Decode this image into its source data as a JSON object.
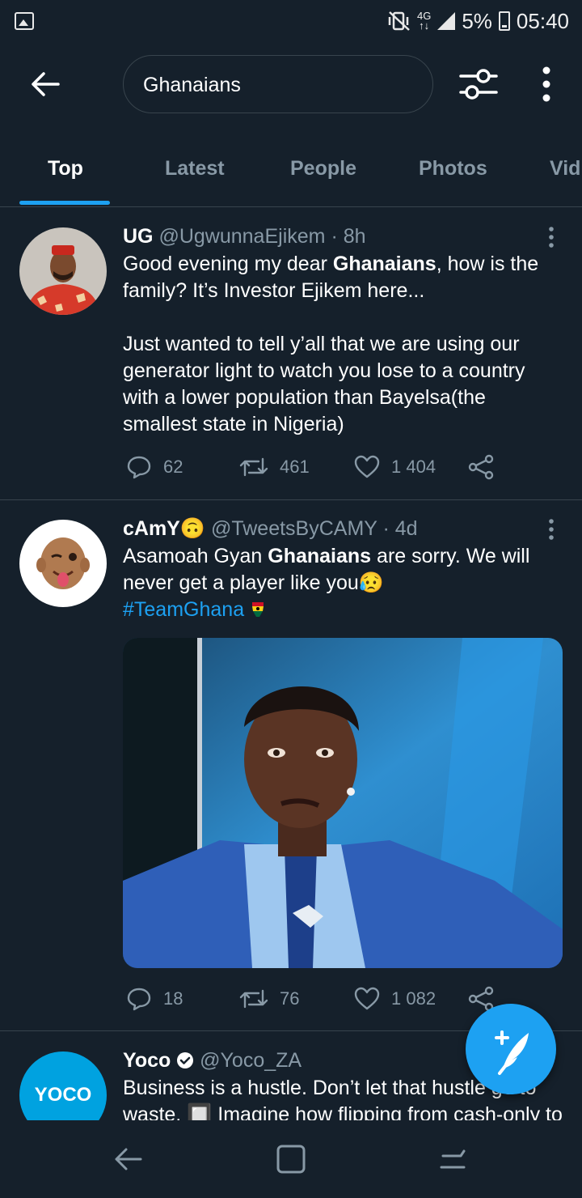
{
  "status_bar": {
    "network_top": "4G",
    "network_bottom": "↑↓",
    "battery": "5%",
    "time": "05:40"
  },
  "search": {
    "query": "Ghanaians"
  },
  "tabs": [
    {
      "label": "Top",
      "active": true
    },
    {
      "label": "Latest",
      "active": false
    },
    {
      "label": "People",
      "active": false
    },
    {
      "label": "Photos",
      "active": false
    },
    {
      "label": "Vid",
      "active": false
    }
  ],
  "tweets": [
    {
      "name": "UG",
      "handle": "@UgwunnaEjikem",
      "time": "· 8h",
      "text_parts": [
        "Good evening my dear ",
        "Ghanaians",
        ", how is the family? It’s Investor Ejikem here..."
      ],
      "text_para2": "Just wanted to tell y’all that we are using our generator light to watch you lose to a country with a lower population than Bayelsa(the smallest state in Nigeria)",
      "replies": "62",
      "retweets": "461",
      "likes": "1 404"
    },
    {
      "name": "cAmY",
      "name_emoji": "🙃",
      "handle": "@TweetsByCAMY",
      "time": "· 4d",
      "text_parts": [
        "Asamoah Gyan ",
        "Ghanaians",
        " are sorry. We will never get a player like you"
      ],
      "text_emoji": "😥",
      "hashtag": "#TeamGhana",
      "replies": "18",
      "retweets": "76",
      "likes": "1 082"
    },
    {
      "name": "Yoco",
      "handle": "@Yoco_ZA",
      "avatar_text": "YOCO",
      "text": "Business is a hustle. Don’t let that hustle go to waste. 🔲 Imagine how flipping from cash-only to"
    }
  ],
  "colors": {
    "background": "#15202b",
    "accent": "#1da1f2",
    "secondary_text": "#8899a6",
    "divider": "#38444d"
  }
}
